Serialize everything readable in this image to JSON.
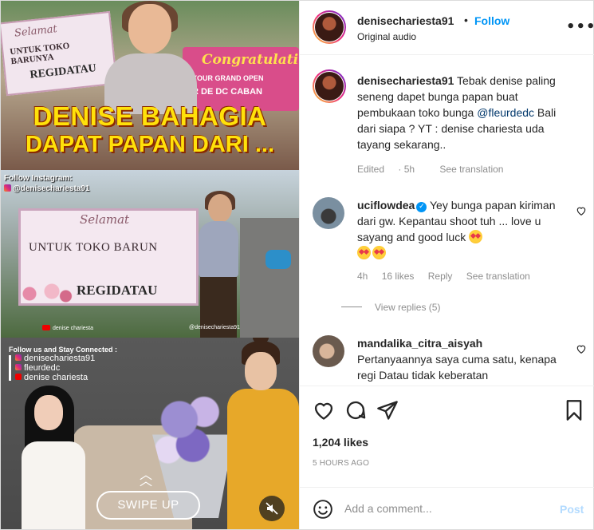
{
  "media": {
    "panel1": {
      "board_small_title": "Selamat",
      "board_small_line": "UNTUK TOKO BARUNYA",
      "board_small_from": "REGIDATAU",
      "congrats_title": "Congratulati",
      "congrats_line1": "YOUR GRAND OPEN",
      "congrats_line2": "R DE DC CABAN",
      "headline1": "DENISE BAHAGIA",
      "headline2": "DAPAT PAPAN DARI ..."
    },
    "panel2": {
      "follow_label": "Follow Instagram:",
      "follow_handle": "@denisechariesta91",
      "board_title": "Selamat",
      "board_line": "UNTUK TOKO BARUN",
      "board_from": "REGIDATAU",
      "youtube_label": "denise chariesta",
      "ig_label": "@denisechariesta91"
    },
    "panel3": {
      "follow_title": "Follow us and Stay Connected :",
      "links": [
        "denisechariesta91",
        "fleurdedc",
        "denise chariesta"
      ],
      "swipe_label": "SWIPE UP"
    }
  },
  "header": {
    "username": "denisechariesta91",
    "dot": "•",
    "follow_label": "Follow",
    "audio_label": "Original audio",
    "more_label": "•••"
  },
  "caption": {
    "username": "denisechariesta91",
    "text_before": "Tebak denise paling seneng dapet bunga papan buat pembukaan toko bunga ",
    "mention": "@fleurdedc",
    "text_after": " Bali dari siapa ? YT : denise chariesta uda tayang sekarang..",
    "edited": "Edited",
    "time": "5h",
    "see_translation": "See translation"
  },
  "comments": [
    {
      "username": "uciflowdea",
      "text": "Yey bunga papan kiriman dari gw. Kepantau shoot tuh ... love u sayang and good luck",
      "time": "4h",
      "likes": "16 likes",
      "reply": "Reply",
      "see_translation": "See translation",
      "view_replies": "View replies (5)"
    },
    {
      "username": "mandalika_citra_aisyah",
      "text": "Pertanyaannya saya cuma satu, kenapa regi Datau tidak keberatan"
    }
  ],
  "actions": {
    "likes": "1,204 likes",
    "time_ago": "5 HOURS AGO"
  },
  "add_comment": {
    "placeholder": "Add a comment...",
    "post_label": "Post"
  },
  "colors": {
    "link_blue": "#0095f6",
    "mention_blue": "#00376b",
    "post_disabled": "#b3dbff",
    "muted_text": "#8e8e8e"
  }
}
